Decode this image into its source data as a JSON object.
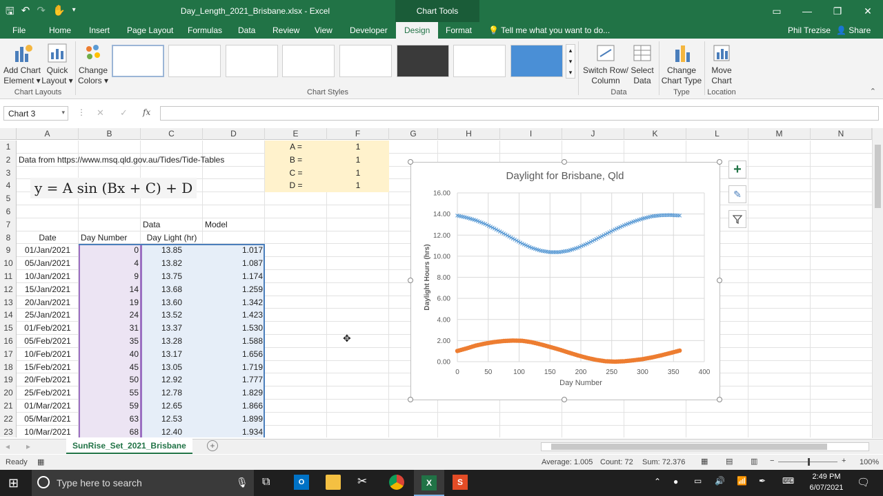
{
  "window": {
    "title": "Day_Length_2021_Brisbane.xlsx - Excel",
    "context_tab": "Chart Tools"
  },
  "tabs": [
    {
      "label": "File"
    },
    {
      "label": "Home"
    },
    {
      "label": "Insert"
    },
    {
      "label": "Page Layout"
    },
    {
      "label": "Formulas"
    },
    {
      "label": "Data"
    },
    {
      "label": "Review"
    },
    {
      "label": "View"
    },
    {
      "label": "Developer"
    },
    {
      "label": "Design"
    },
    {
      "label": "Format"
    }
  ],
  "tell_me": "Tell me what you want to do...",
  "user": "Phil Trezise",
  "share": "Share",
  "ribbon": {
    "add_chart_element": "Add Chart Element",
    "quick_layout": "Quick Layout",
    "change_colors": "Change Colors",
    "group_chart_layouts": "Chart Layouts",
    "group_chart_styles": "Chart Styles",
    "switch_row_column": "Switch Row/ Column",
    "select_data": "Select Data",
    "group_data": "Data",
    "change_chart_type": "Change Chart Type",
    "group_type": "Type",
    "move_chart": "Move Chart",
    "group_location": "Location"
  },
  "name_box": "Chart 3",
  "columns": [
    "A",
    "B",
    "C",
    "D",
    "E",
    "F",
    "G",
    "H",
    "I",
    "J",
    "K",
    "L",
    "M",
    "N"
  ],
  "rows": [
    "1",
    "2",
    "3",
    "4",
    "5",
    "6",
    "7",
    "8",
    "9",
    "10",
    "11",
    "12",
    "13",
    "14",
    "15",
    "16",
    "17",
    "18",
    "19",
    "20",
    "21",
    "22",
    "23"
  ],
  "cells": {
    "source": "Data from https://www.msq.qld.gov.au/Tides/Tide-Tables",
    "equation": "y = A sin (Bx + C) + D",
    "labels": [
      "A =",
      "B =",
      "C =",
      "D ="
    ],
    "params": [
      "1",
      "1",
      "1",
      "1"
    ],
    "h_data": "Data",
    "h_model": "Model",
    "h_date": "Date",
    "h_daynum": "Day Number",
    "h_daylight": "Day Light (hr)"
  },
  "table": [
    [
      "01/Jan/2021",
      "0",
      "13.85",
      "1.017"
    ],
    [
      "05/Jan/2021",
      "4",
      "13.82",
      "1.087"
    ],
    [
      "10/Jan/2021",
      "9",
      "13.75",
      "1.174"
    ],
    [
      "15/Jan/2021",
      "14",
      "13.68",
      "1.259"
    ],
    [
      "20/Jan/2021",
      "19",
      "13.60",
      "1.342"
    ],
    [
      "25/Jan/2021",
      "24",
      "13.52",
      "1.423"
    ],
    [
      "01/Feb/2021",
      "31",
      "13.37",
      "1.530"
    ],
    [
      "05/Feb/2021",
      "35",
      "13.28",
      "1.588"
    ],
    [
      "10/Feb/2021",
      "40",
      "13.17",
      "1.656"
    ],
    [
      "15/Feb/2021",
      "45",
      "13.05",
      "1.719"
    ],
    [
      "20/Feb/2021",
      "50",
      "12.92",
      "1.777"
    ],
    [
      "25/Feb/2021",
      "55",
      "12.78",
      "1.829"
    ],
    [
      "01/Mar/2021",
      "59",
      "12.65",
      "1.866"
    ],
    [
      "05/Mar/2021",
      "63",
      "12.53",
      "1.899"
    ],
    [
      "10/Mar/2021",
      "68",
      "12.40",
      "1.934"
    ]
  ],
  "chart_data": {
    "type": "scatter",
    "title": "Daylight for Brisbane, Qld",
    "xlabel": "Day Number",
    "ylabel": "Daylight Hours (hrs)",
    "xlim": [
      0,
      400
    ],
    "ylim": [
      0,
      16
    ],
    "x_ticks": [
      "0",
      "50",
      "100",
      "150",
      "200",
      "250",
      "300",
      "350",
      "400"
    ],
    "y_ticks": [
      "0.00",
      "2.00",
      "4.00",
      "6.00",
      "8.00",
      "10.00",
      "12.00",
      "14.00",
      "16.00"
    ],
    "grid": true,
    "series": [
      {
        "color": "#5b9bd5",
        "marker": "x",
        "x": [
          0,
          15,
          30,
          45,
          60,
          75,
          90,
          105,
          120,
          135,
          150,
          165,
          180,
          195,
          210,
          225,
          240,
          255,
          270,
          285,
          300,
          315,
          330,
          345,
          360
        ],
        "y": [
          13.85,
          13.66,
          13.4,
          13.05,
          12.62,
          12.15,
          11.67,
          11.19,
          10.8,
          10.52,
          10.38,
          10.38,
          10.52,
          10.8,
          11.18,
          11.62,
          12.08,
          12.53,
          12.93,
          13.27,
          13.56,
          13.78,
          13.88,
          13.9,
          13.85
        ]
      },
      {
        "color": "#ed7d31",
        "marker": "circle",
        "x": [
          0,
          15,
          30,
          45,
          60,
          75,
          90,
          105,
          120,
          135,
          150,
          165,
          180,
          195,
          210,
          225,
          240,
          255,
          270,
          285,
          300,
          315,
          330,
          345,
          360
        ],
        "y": [
          1.017,
          1.259,
          1.53,
          1.719,
          1.866,
          1.96,
          2.0,
          1.98,
          1.85,
          1.64,
          1.4,
          1.15,
          0.87,
          0.6,
          0.36,
          0.17,
          0.04,
          0.0,
          0.04,
          0.13,
          0.24,
          0.4,
          0.6,
          0.82,
          1.05
        ]
      }
    ]
  },
  "sheet_tab": "SunRise_Set_2021_Brisbane",
  "status": {
    "ready": "Ready",
    "average": "Average: 1.005",
    "count": "Count: 72",
    "sum": "Sum: 72.376",
    "zoom": "100%"
  },
  "taskbar": {
    "search": "Type here to search",
    "time": "2:49 PM",
    "date": "6/07/2021"
  }
}
